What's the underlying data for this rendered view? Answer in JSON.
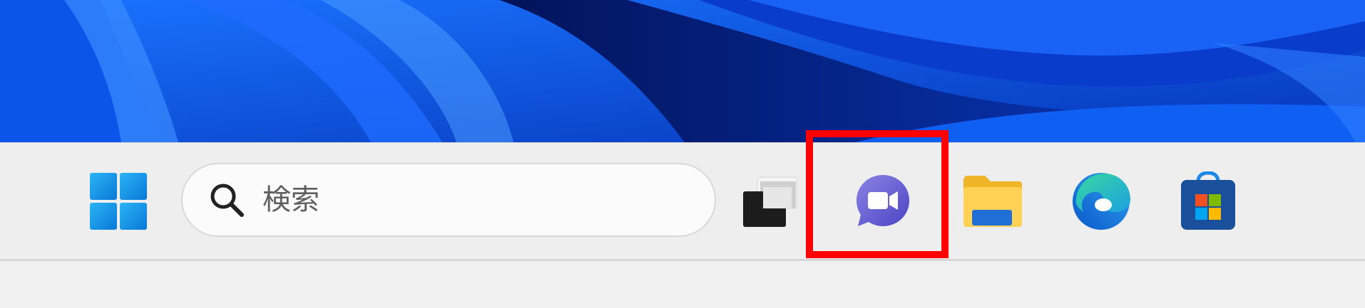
{
  "taskbar": {
    "start": {
      "icon": "windows-logo-icon"
    },
    "search": {
      "placeholder": "検索",
      "icon": "search-icon"
    },
    "apps": [
      {
        "name": "task-view",
        "icon": "task-view-icon"
      },
      {
        "name": "teams-chat",
        "icon": "teams-chat-icon",
        "highlighted": true
      },
      {
        "name": "file-explorer",
        "icon": "folder-icon"
      },
      {
        "name": "edge",
        "icon": "edge-icon"
      },
      {
        "name": "microsoft-store",
        "icon": "store-icon"
      }
    ]
  },
  "highlight": {
    "color": "#ff0000"
  },
  "colors": {
    "wallpaper": "#0a4fe0",
    "taskbar": "#eeeeee",
    "teams": "#6b62d4"
  }
}
